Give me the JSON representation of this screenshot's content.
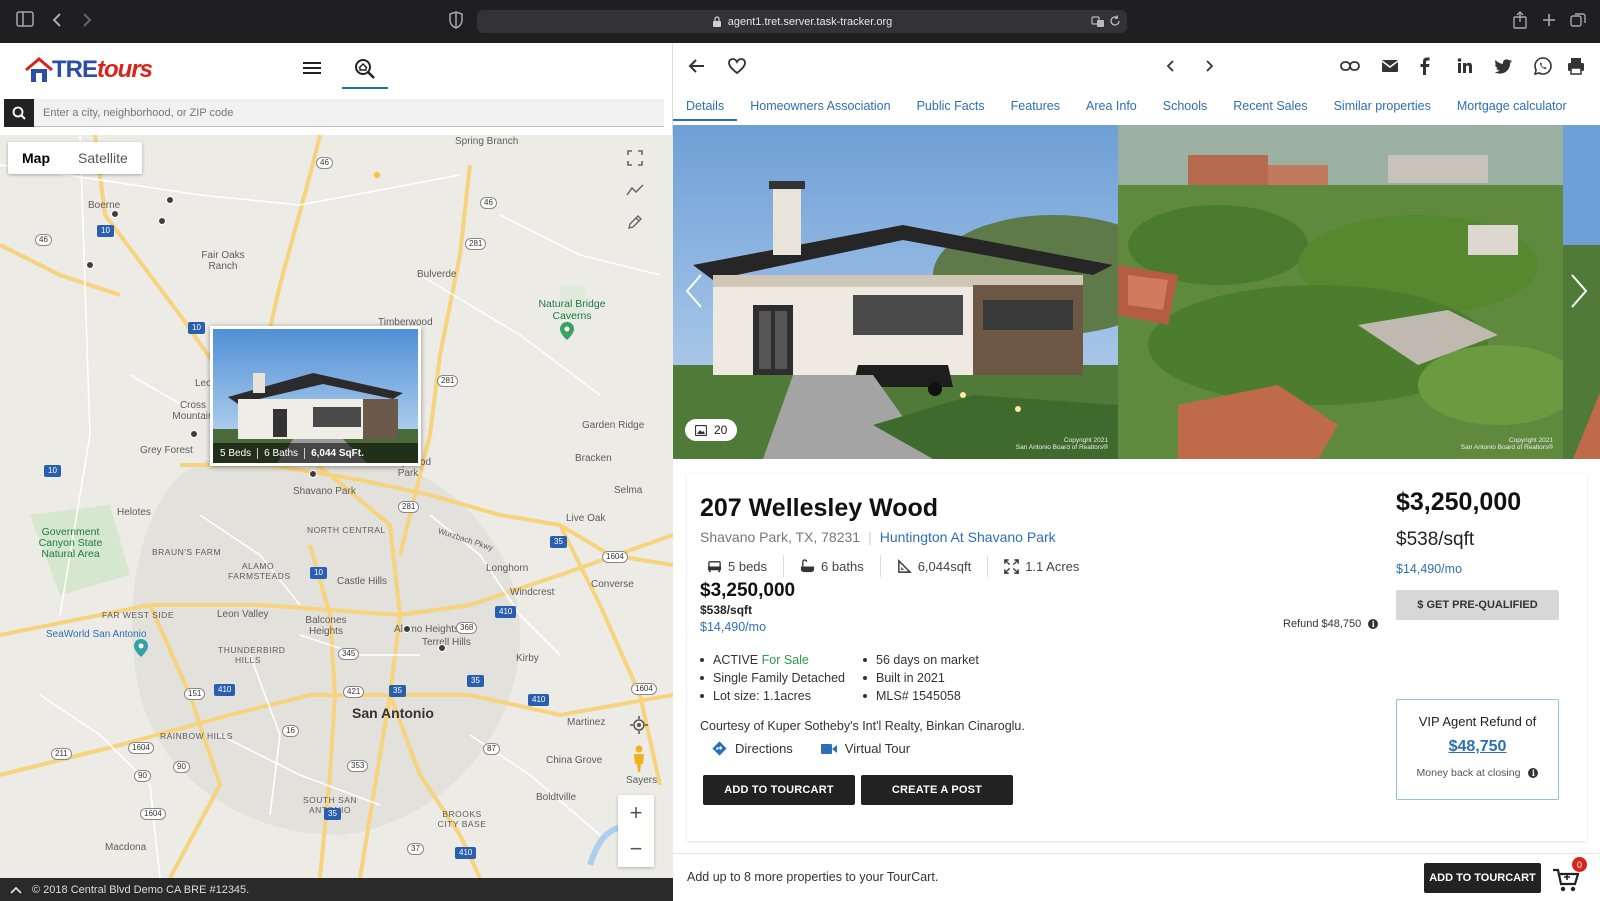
{
  "browser": {
    "url": "agent1.tret.server.task-tracker.org",
    "icons": [
      "sidebar-icon",
      "back-icon",
      "forward-icon",
      "shield-icon",
      "lock-icon",
      "translate-icon",
      "reload-icon",
      "share-icon",
      "new-tab-icon",
      "tabs-overview-icon"
    ]
  },
  "brand": {
    "name_main": "TRE",
    "name_accent": "tours",
    "accent_color": "#d9241c",
    "brand_color": "#2b4ea8"
  },
  "search": {
    "placeholder": "Enter a city, neighborhood, or ZIP code"
  },
  "map": {
    "toggle": {
      "map": "Map",
      "satellite": "Satellite",
      "selected": "Map"
    },
    "popup": {
      "beds": "5 Beds",
      "baths": "6 Baths",
      "sqft": "6,044 SqFt."
    },
    "places": [
      "Spring Branch",
      "Boerne",
      "Fair Oaks Ranch",
      "Bulverde",
      "Natural Bridge Caverns",
      "Timberwood",
      "Leo",
      "Cross Mountain",
      "Grey Forest",
      "Garden Ridge",
      "Bracken",
      "Hollywood Park",
      "Shavano Park",
      "Selma",
      "Helotes",
      "Government Canyon State Natural Area",
      "BRAUN'S FARM",
      "NORTH CENTRAL",
      "Live Oak",
      "Wurzbach Pkwy",
      "ALAMO FARMSTEADS",
      "Castle Hills",
      "Longhorn",
      "Windcrest",
      "Converse",
      "FAR WEST SIDE",
      "Leon Valley",
      "Balcones Heights",
      "Alamo Heights",
      "Terrell Hills",
      "Kirby",
      "SeaWorld San Antonio",
      "THUNDERBIRD HILLS",
      "San Antonio",
      "Martinez",
      "RAINBOW HILLS",
      "China Grove",
      "Sayers",
      "SOUTH SAN ANTONIO",
      "BROOKS CITY BASE",
      "Boldtville",
      "Macdona"
    ],
    "shields": [
      "46",
      "46",
      "46",
      "281",
      "281",
      "10",
      "10",
      "10",
      "10",
      "35",
      "35",
      "35",
      "35",
      "1604",
      "1604",
      "1604",
      "1604",
      "151",
      "90",
      "90",
      "211",
      "410",
      "410",
      "410",
      "410",
      "368",
      "345",
      "421",
      "87",
      "353",
      "37",
      "16",
      "281"
    ]
  },
  "footer": {
    "copyright": "© 2018 Central Blvd Demo CA BRE #12345."
  },
  "tabs": [
    "Details",
    "Homeowners Association",
    "Public Facts",
    "Features",
    "Area Info",
    "Schools",
    "Recent Sales",
    "Similar properties",
    "Mortgage calculator"
  ],
  "active_tab": "Details",
  "gallery": {
    "photo_count": "20",
    "copyright_1": "Copyright 2021",
    "copyright_2": "San Antonio Board of Realtors®"
  },
  "listing": {
    "address": "207 Wellesley Wood",
    "city": "Shavano Park, TX, 78231",
    "subdivision": "Huntington At Shavano Park",
    "beds": "5 beds",
    "baths": "6 baths",
    "sqft": "6,044sqft",
    "acres": "1.1 Acres",
    "price": "$3,250,000",
    "price_sqft": "$538/sqft",
    "monthly": "$14,490/mo",
    "status": "ACTIVE",
    "status_detail": "For Sale",
    "type": "Single Family Detached",
    "lot": "Lot size: 1.1acres",
    "days": "56 days on market",
    "built": "Built in 2021",
    "mls": "MLS# 1545058",
    "courtesy": "Courtesy of Kuper Sotheby's Int'l Realty, Binkan Cinaroglu.",
    "directions": "Directions",
    "virtual_tour": "Virtual Tour",
    "add_tourcart": "ADD TO TOURCART",
    "create_post": "CREATE A POST",
    "refund_text": "Refund $48,750",
    "pre_qualified": "$ GET PRE-QUALIFIED",
    "vip_title": "VIP Agent Refund of",
    "vip_amount": "$48,750",
    "vip_note": "Money back at closing"
  },
  "tourbar": {
    "message": "Add up to 8 more properties to your TourCart.",
    "button": "ADD TO TOURCART",
    "count": "0"
  },
  "colors": {
    "link": "#2d6fb7",
    "active_green": "#2a9a47",
    "dark_button": "#222222"
  }
}
